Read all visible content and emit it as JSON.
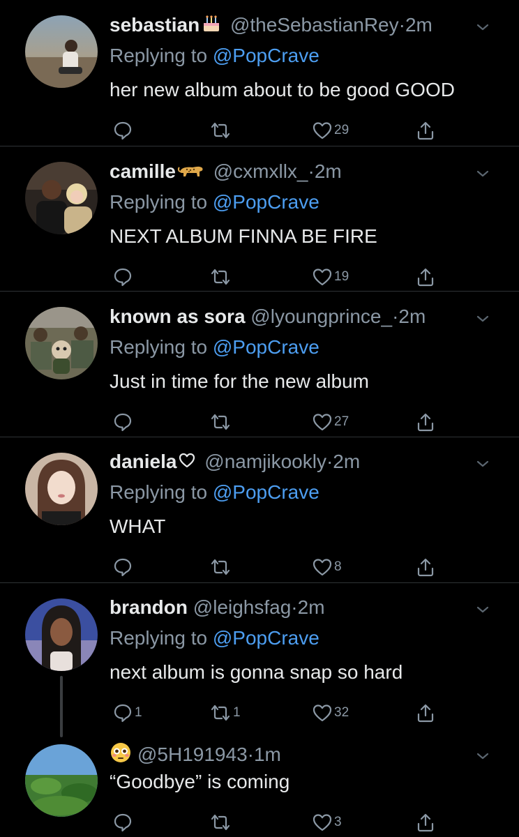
{
  "replying_label": "Replying to",
  "tweets": [
    {
      "name": "sebastian",
      "name_emoji": "birthday-cake",
      "handle": "@theSebastianRey",
      "dot": "·",
      "time": "2m",
      "replying_to": "@PopCrave",
      "text": "her new album about to be good GOOD",
      "replies": "",
      "retweets": "",
      "likes": "29"
    },
    {
      "name": "camille",
      "name_emoji": "leopard",
      "handle": "@cxmxllx_",
      "dot": "·",
      "time": "2m",
      "replying_to": "@PopCrave",
      "text": "NEXT ALBUM FINNA BE FIRE",
      "replies": "",
      "retweets": "",
      "likes": "19"
    },
    {
      "name": "known as sora",
      "name_emoji": "",
      "handle": "@lyoungprince_",
      "dot": "·",
      "time": "2m",
      "replying_to": "@PopCrave",
      "text": "Just in time for the new album",
      "replies": "",
      "retweets": "",
      "likes": "27"
    },
    {
      "name": "daniela",
      "name_emoji": "white-heart",
      "handle": "@namjikookly",
      "dot": "·",
      "time": "2m",
      "replying_to": "@PopCrave",
      "text": "WHAT",
      "replies": "",
      "retweets": "",
      "likes": "8"
    },
    {
      "name": "brandon",
      "name_emoji": "",
      "handle": "@leighsfag",
      "dot": "·",
      "time": "2m",
      "replying_to": "@PopCrave",
      "text": "next album is gonna snap so hard",
      "replies": "1",
      "retweets": "1",
      "likes": "32"
    },
    {
      "name": "",
      "name_emoji": "flushed-face",
      "handle": "@5H191943",
      "dot": "·",
      "time": "1m",
      "replying_to": "",
      "text": "“Goodbye” is coming",
      "replies": "",
      "retweets": "",
      "likes": "3"
    }
  ],
  "colors": {
    "background": "#000000",
    "text": "#e7e9ea",
    "secondary": "#8b98a5",
    "link": "#4d9ef1",
    "divider": "#2f3336"
  },
  "icons": [
    "reply-icon",
    "retweet-icon",
    "like-icon",
    "share-icon",
    "caret-down-icon"
  ]
}
